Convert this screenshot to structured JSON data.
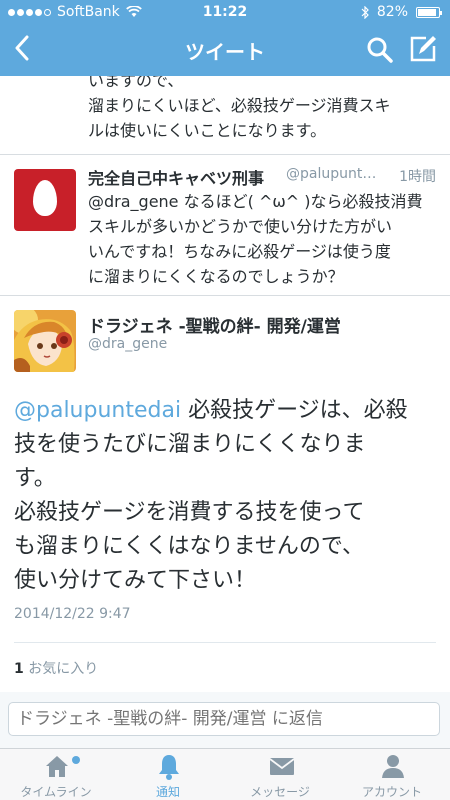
{
  "status": {
    "carrier": "SoftBank",
    "time": "11:22",
    "battery": "82%"
  },
  "nav": {
    "title": "ツイート"
  },
  "previous_tweet": {
    "lines": [
      "いますので、",
      "溜まりにくいほど、必殺技ゲージ消費スキ",
      "ルは使いにくいことになります。"
    ]
  },
  "reply_tweet": {
    "name": "完全自己中キャベツ刑事",
    "handle": "@palupunt…",
    "time": "1時間",
    "lines": [
      "@dra_gene なるほど( ^ω^ )なら必殺技消費",
      "スキルが多いかどうかで使い分けた方がい",
      "いんですね！ちなみに必殺ゲージは使う度",
      "に溜まりにくくなるのでしょうか？"
    ]
  },
  "main_tweet": {
    "name": "ドラジェネ -聖戦の絆- 開発/運営",
    "handle": "@dra_gene",
    "mention": "@palupuntedai",
    "line1_rest": " 必殺技ゲージは、必殺",
    "lines": [
      "技を使うたびに溜まりにくくなりま",
      "す。",
      "必殺技ゲージを消費する技を使って",
      "も溜まりにくくはなりませんので、",
      "使い分けてみて下さい！"
    ],
    "date": "2014/12/22 9:47",
    "fav_count": "1",
    "fav_label": " お気に入り"
  },
  "reply_box": {
    "placeholder": "ドラジェネ -聖戦の絆- 開発/運営 に返信"
  },
  "tabs": [
    {
      "label": "タイムライン",
      "icon": "home-icon"
    },
    {
      "label": "通知",
      "icon": "bell-icon",
      "active": true
    },
    {
      "label": "メッセージ",
      "icon": "envelope-icon"
    },
    {
      "label": "アカウント",
      "icon": "person-icon"
    }
  ],
  "colors": {
    "accent": "#5ea9dd",
    "egg_avatar": "#c82029"
  }
}
